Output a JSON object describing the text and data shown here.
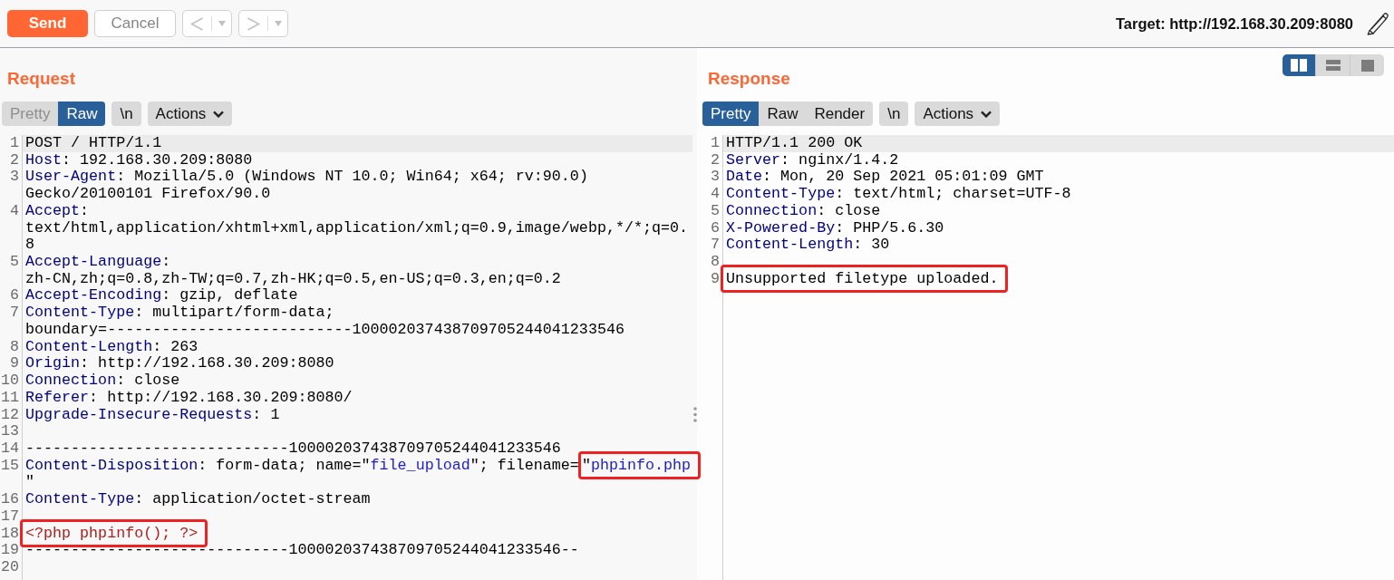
{
  "toolbar": {
    "buttons": [
      {
        "kind": "send",
        "label": "Send",
        "disabled": false
      },
      {
        "kind": "cancel",
        "label": "Cancel",
        "disabled": true
      }
    ],
    "history": [
      {
        "kind": "back",
        "disabled": true
      },
      {
        "kind": "forward",
        "disabled": true
      }
    ],
    "target": "Target: http://192.168.30.209:8080"
  },
  "layout_options": [
    {
      "kind": "side_by_side",
      "selected": true
    },
    {
      "kind": "stacked",
      "selected": false
    },
    {
      "kind": "single",
      "selected": false
    }
  ],
  "panes": [
    {
      "title": "Request",
      "view_tabs": [
        {
          "label": "Pretty",
          "selected": false,
          "disabled": true
        },
        {
          "label": "Raw",
          "selected": true,
          "disabled": false
        }
      ],
      "newline_toggle": "\\n",
      "actions": "Actions",
      "lines": [
        {
          "number": "1",
          "current": true,
          "parts": [
            {
              "kind": "plain",
              "text": "POST / HTTP/1.1"
            }
          ]
        },
        {
          "number": "2",
          "current": false,
          "parts": [
            {
              "kind": "key",
              "text": "Host"
            },
            {
              "kind": "plain",
              "text": ": 192.168.30.209:8080"
            }
          ]
        },
        {
          "number": "3",
          "current": false,
          "parts": [
            {
              "kind": "key",
              "text": "User-Agent"
            },
            {
              "kind": "plain",
              "text": ": Mozilla/5.0 (Windows NT 10.0; Win64; x64; rv:90.0) Gecko/20100101 Firefox/90.0"
            }
          ]
        },
        {
          "number": "4",
          "current": false,
          "parts": [
            {
              "kind": "key",
              "text": "Accept"
            },
            {
              "kind": "plain",
              "text": ": text/html,application/xhtml+xml,application/xml;q=0.9,image/webp,*/*;q=0.8"
            }
          ]
        },
        {
          "number": "5",
          "current": false,
          "parts": [
            {
              "kind": "key",
              "text": "Accept-Language"
            },
            {
              "kind": "plain",
              "text": ": zh-CN,zh;q=0.8,zh-TW;q=0.7,zh-HK;q=0.5,en-US;q=0.3,en;q=0.2"
            }
          ]
        },
        {
          "number": "6",
          "current": false,
          "parts": [
            {
              "kind": "key",
              "text": "Accept-Encoding"
            },
            {
              "kind": "plain",
              "text": ": gzip, deflate"
            }
          ]
        },
        {
          "number": "7",
          "current": false,
          "parts": [
            {
              "kind": "key",
              "text": "Content-Type"
            },
            {
              "kind": "plain",
              "text": ": multipart/form-data; boundary=---------------------------100002037438709705244041233546"
            }
          ]
        },
        {
          "number": "8",
          "current": false,
          "parts": [
            {
              "kind": "key",
              "text": "Content-Length"
            },
            {
              "kind": "plain",
              "text": ": 263"
            }
          ]
        },
        {
          "number": "9",
          "current": false,
          "parts": [
            {
              "kind": "key",
              "text": "Origin"
            },
            {
              "kind": "plain",
              "text": ": http://192.168.30.209:8080"
            }
          ]
        },
        {
          "number": "10",
          "current": false,
          "parts": [
            {
              "kind": "key",
              "text": "Connection"
            },
            {
              "kind": "plain",
              "text": ": close"
            }
          ]
        },
        {
          "number": "11",
          "current": false,
          "parts": [
            {
              "kind": "key",
              "text": "Referer"
            },
            {
              "kind": "plain",
              "text": ": http://192.168.30.209:8080/"
            }
          ]
        },
        {
          "number": "12",
          "current": false,
          "parts": [
            {
              "kind": "key",
              "text": "Upgrade-Insecure-Requests"
            },
            {
              "kind": "plain",
              "text": ": 1"
            }
          ]
        },
        {
          "number": "13",
          "current": false
        },
        {
          "number": "14",
          "current": false,
          "parts": [
            {
              "kind": "plain",
              "text": "-----------------------------100002037438709705244041233546"
            }
          ]
        },
        {
          "number": "15",
          "current": false,
          "parts": [
            {
              "kind": "key",
              "text": "Content-Disposition"
            },
            {
              "kind": "plain",
              "text": ": form-data; name=\""
            },
            {
              "kind": "string",
              "text": "file_upload"
            },
            {
              "kind": "plain",
              "text": "\"; filename="
            },
            {
              "kind": "mark",
              "parts": [
                {
                  "kind": "plain",
                  "text": "\""
                },
                {
                  "kind": "string",
                  "text": "phpinfo.php"
                }
              ]
            },
            {
              "kind": "plain",
              "text": "\""
            }
          ]
        },
        {
          "number": "16",
          "current": false,
          "parts": [
            {
              "kind": "key",
              "text": "Content-Type"
            },
            {
              "kind": "plain",
              "text": ": application/octet-stream"
            }
          ]
        },
        {
          "number": "17",
          "current": false
        },
        {
          "number": "18",
          "current": false,
          "parts": [
            {
              "kind": "mark",
              "parts": [
                {
                  "kind": "body",
                  "text": "<?php phpinfo(); ?>"
                }
              ]
            }
          ]
        },
        {
          "number": "19",
          "current": false,
          "parts": [
            {
              "kind": "plain",
              "text": "-----------------------------100002037438709705244041233546--"
            }
          ]
        },
        {
          "number": "20",
          "current": false
        }
      ]
    },
    {
      "title": "Response",
      "view_tabs": [
        {
          "label": "Pretty",
          "selected": true,
          "disabled": false
        },
        {
          "label": "Raw",
          "selected": false,
          "disabled": false
        },
        {
          "label": "Render",
          "selected": false,
          "disabled": false
        }
      ],
      "newline_toggle": "\\n",
      "actions": "Actions",
      "lines": [
        {
          "number": "1",
          "current": true,
          "parts": [
            {
              "kind": "plain",
              "text": "HTTP/1.1 200 OK"
            }
          ]
        },
        {
          "number": "2",
          "current": false,
          "parts": [
            {
              "kind": "key",
              "text": "Server"
            },
            {
              "kind": "plain",
              "text": ": nginx/1.4.2"
            }
          ]
        },
        {
          "number": "3",
          "current": false,
          "parts": [
            {
              "kind": "key",
              "text": "Date"
            },
            {
              "kind": "plain",
              "text": ": Mon, 20 Sep 2021 05:01:09 GMT"
            }
          ]
        },
        {
          "number": "4",
          "current": false,
          "parts": [
            {
              "kind": "key",
              "text": "Content-Type"
            },
            {
              "kind": "plain",
              "text": ": text/html; charset=UTF-8"
            }
          ]
        },
        {
          "number": "5",
          "current": false,
          "parts": [
            {
              "kind": "key",
              "text": "Connection"
            },
            {
              "kind": "plain",
              "text": ": close"
            }
          ]
        },
        {
          "number": "6",
          "current": false,
          "parts": [
            {
              "kind": "key",
              "text": "X-Powered-By"
            },
            {
              "kind": "plain",
              "text": ": PHP/5.6.30"
            }
          ]
        },
        {
          "number": "7",
          "current": false,
          "parts": [
            {
              "kind": "key",
              "text": "Content-Length"
            },
            {
              "kind": "plain",
              "text": ": 30"
            }
          ]
        },
        {
          "number": "8",
          "current": false
        },
        {
          "number": "9",
          "current": false,
          "parts": [
            {
              "kind": "mark",
              "parts": [
                {
                  "kind": "plain",
                  "text": "Unsupported filetype uploaded."
                }
              ]
            }
          ]
        }
      ]
    }
  ]
}
